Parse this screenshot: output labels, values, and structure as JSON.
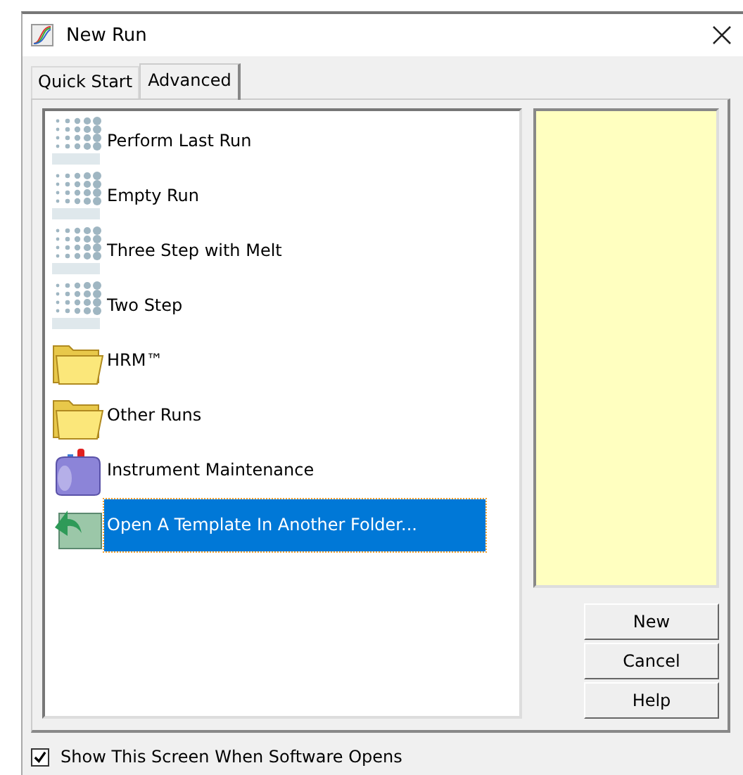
{
  "window": {
    "title": "New Run"
  },
  "tabs": [
    {
      "label": "Quick Start",
      "selected": false
    },
    {
      "label": "Advanced",
      "selected": true
    }
  ],
  "templates": [
    {
      "kind": "logo",
      "label": "Perform Last Run",
      "selected": false
    },
    {
      "kind": "logo",
      "label": "Empty Run",
      "selected": false
    },
    {
      "kind": "logo",
      "label": "Three Step with Melt",
      "selected": false
    },
    {
      "kind": "logo",
      "label": "Two Step",
      "selected": false
    },
    {
      "kind": "folder",
      "label": "HRM™",
      "selected": false
    },
    {
      "kind": "folder",
      "label": "Other Runs",
      "selected": false
    },
    {
      "kind": "toolbox",
      "label": "Instrument Maintenance",
      "selected": false
    },
    {
      "kind": "open",
      "label": "Open A Template In Another Folder...",
      "selected": true
    }
  ],
  "buttons": [
    "New",
    "Cancel",
    "Help"
  ],
  "show_on_start": {
    "label": "Show This Screen When Software Opens",
    "checked": true
  }
}
